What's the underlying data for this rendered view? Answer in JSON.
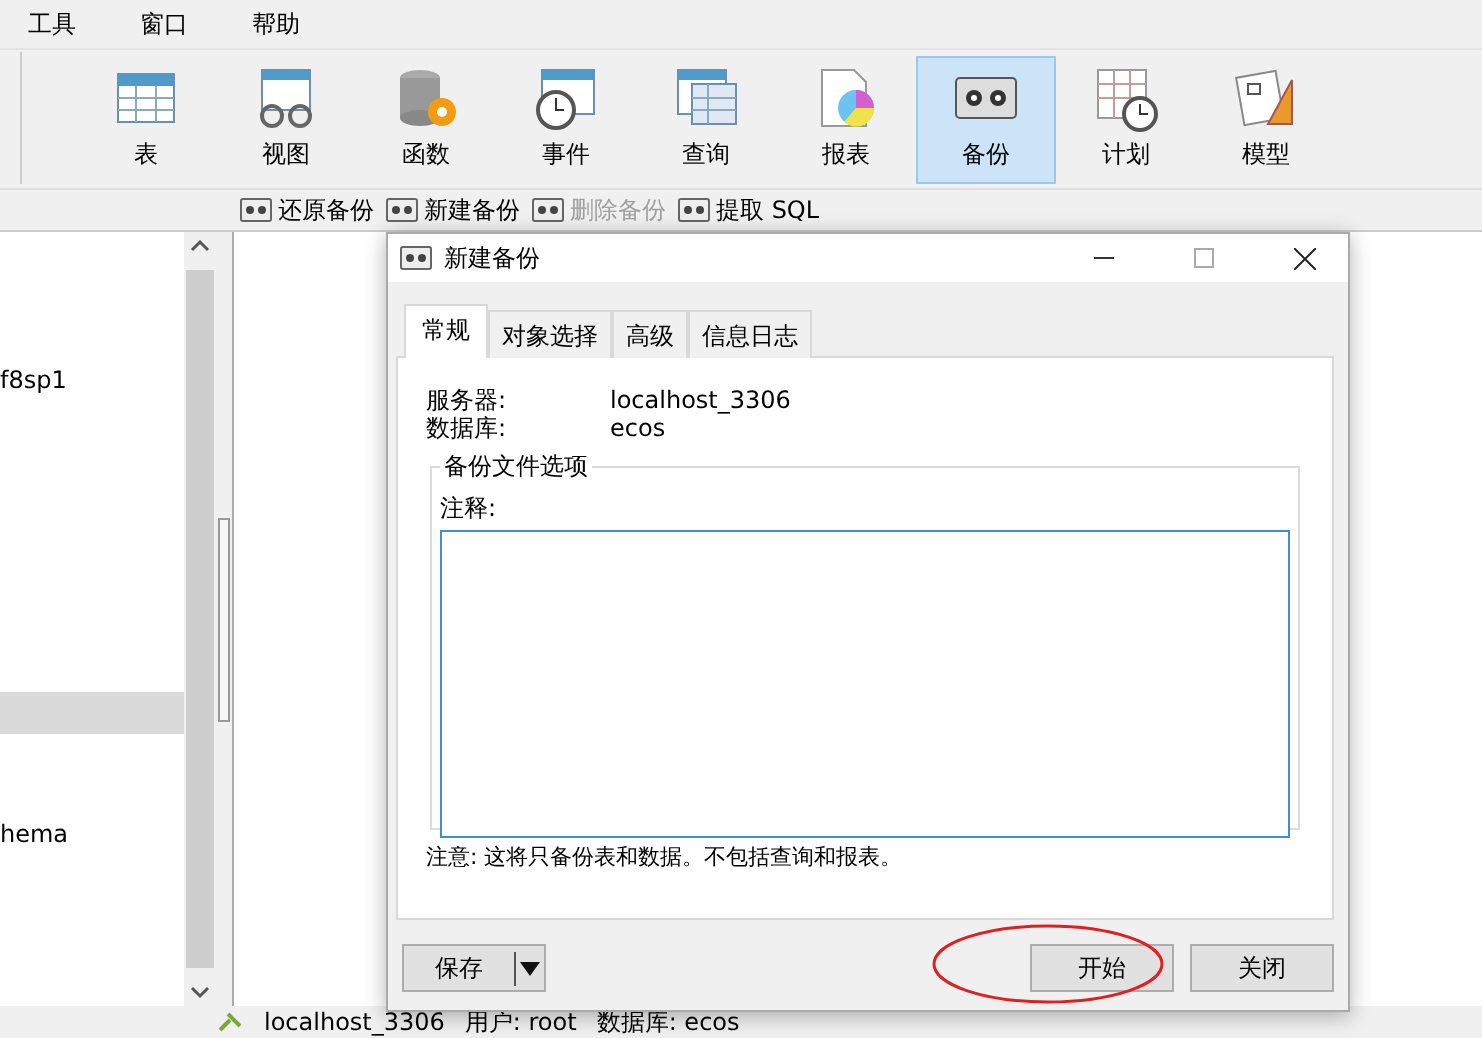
{
  "menu": [
    "工具",
    "窗口",
    "帮助"
  ],
  "toolbar": [
    {
      "label": "表",
      "selected": false
    },
    {
      "label": "视图",
      "selected": false
    },
    {
      "label": "函数",
      "selected": false
    },
    {
      "label": "事件",
      "selected": false
    },
    {
      "label": "查询",
      "selected": false
    },
    {
      "label": "报表",
      "selected": false
    },
    {
      "label": "备份",
      "selected": true
    },
    {
      "label": "计划",
      "selected": false
    },
    {
      "label": "模型",
      "selected": false
    }
  ],
  "actions": [
    {
      "label": "还原备份",
      "disabled": false
    },
    {
      "label": "新建备份",
      "disabled": false
    },
    {
      "label": "删除备份",
      "disabled": true
    },
    {
      "label": "提取 SQL",
      "disabled": false
    }
  ],
  "sidebar": {
    "items": [
      {
        "label": "f8sp1",
        "selected": false
      },
      {
        "selected": true
      },
      {
        "label": "hema",
        "selected": false
      }
    ]
  },
  "dialog": {
    "title": "新建备份",
    "tabs": [
      {
        "label": "常规",
        "selected": true
      },
      {
        "label": "对象选择",
        "selected": false
      },
      {
        "label": "高级",
        "selected": false
      },
      {
        "label": "信息日志",
        "selected": false
      }
    ],
    "fields": [
      {
        "label": "服务器:",
        "value": "localhost_3306"
      },
      {
        "label": "数据库:",
        "value": "ecos"
      }
    ],
    "group_title": "备份文件选项",
    "comment_label": "注释:",
    "note": "注意: 这将只备份表和数据。不包括查询和报表。",
    "save_button": "保存",
    "start_button": {
      "label": "开始",
      "circled": true
    },
    "close_button": "关闭"
  },
  "status_bar": {
    "connection": "localhost_3306",
    "user": "用户: root",
    "database": "数据库: ecos"
  }
}
